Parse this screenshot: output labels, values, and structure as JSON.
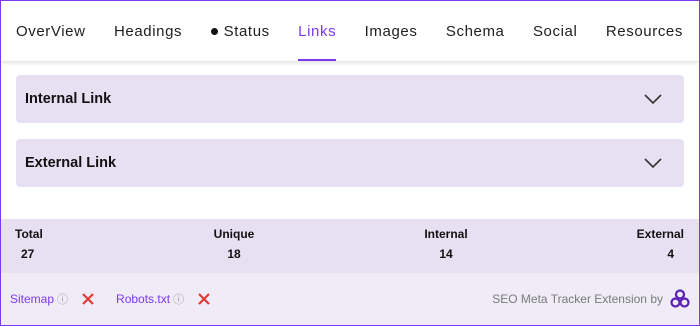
{
  "tabs": [
    {
      "label": "OverView",
      "active": false
    },
    {
      "label": "Headings",
      "active": false
    },
    {
      "label": "Status",
      "active": false,
      "icon": "dot-icon"
    },
    {
      "label": "Links",
      "active": true
    },
    {
      "label": "Images",
      "active": false
    },
    {
      "label": "Schema",
      "active": false
    },
    {
      "label": "Social",
      "active": false
    },
    {
      "label": "Resources",
      "active": false
    }
  ],
  "accordions": [
    {
      "title": "Internal Link"
    },
    {
      "title": "External Link"
    }
  ],
  "stats": {
    "total": {
      "label": "Total",
      "value": "27"
    },
    "unique": {
      "label": "Unique",
      "value": "18"
    },
    "internal": {
      "label": "Internal",
      "value": "14"
    },
    "external": {
      "label": "External",
      "value": "4"
    }
  },
  "footer": {
    "sitemap": {
      "label": "Sitemap",
      "status": "missing"
    },
    "robots": {
      "label": "Robots.txt",
      "status": "missing"
    },
    "brand_text": "SEO Meta Tracker Extension by",
    "info_glyph": "ⓘ"
  },
  "colors": {
    "accent": "#7c3aed",
    "panel": "#e6e0f2",
    "error": "#e53935"
  }
}
